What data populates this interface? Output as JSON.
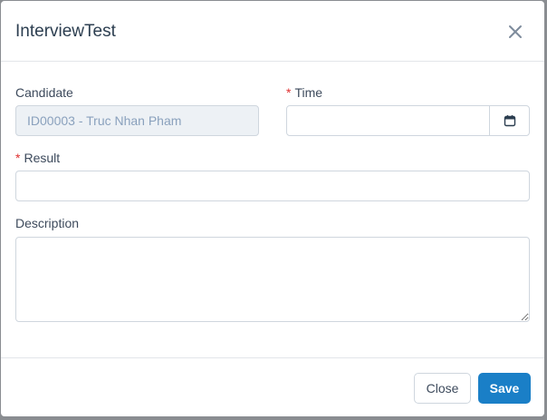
{
  "modal": {
    "title": "InterviewTest"
  },
  "form": {
    "candidate": {
      "label": "Candidate",
      "value": "ID00003 - Truc Nhan Pham"
    },
    "time": {
      "required_mark": "*",
      "label": "Time",
      "value": ""
    },
    "result": {
      "required_mark": "*",
      "label": "Result",
      "value": ""
    },
    "description": {
      "label": "Description",
      "value": ""
    }
  },
  "footer": {
    "close_label": "Close",
    "save_label": "Save"
  },
  "icons": {
    "close": "close-icon",
    "calendar": "calendar-icon"
  },
  "colors": {
    "primary": "#1a7fc7",
    "required": "#e03131",
    "disabled_bg": "#edf1f5"
  }
}
